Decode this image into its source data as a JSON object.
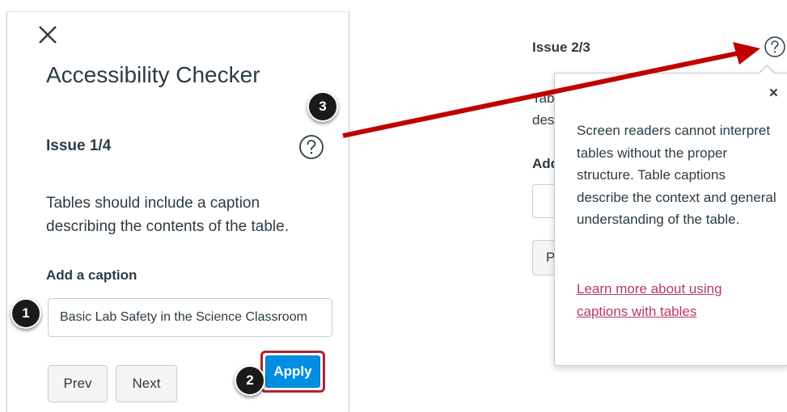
{
  "left_panel": {
    "title": "Accessibility Checker",
    "issue_label": "Issue 1/4",
    "description": "Tables should include a caption describing the contents of the table.",
    "field_label": "Add a caption",
    "caption_value": "Basic Lab Safety in the Science Classroom",
    "prev_label": "Prev",
    "next_label": "Next",
    "apply_label": "Apply"
  },
  "right_panel": {
    "issue_label": "Issue 2/3",
    "fragment_1": "Tab",
    "fragment_2": "des",
    "fragment_3": "Add",
    "fragment_btn": "P"
  },
  "popover": {
    "close_glyph": "×",
    "text": "Screen readers cannot interpret tables without the proper structure. Table captions describe the context and general understanding of the table.",
    "link": "Learn more about using captions with tables"
  },
  "callouts": {
    "one": "1",
    "two": "2",
    "three": "3"
  },
  "colors": {
    "apply_blue": "#008ee2",
    "highlight_red": "#b02231",
    "link_color": "#b8386b",
    "arrow_red": "#c00000"
  }
}
